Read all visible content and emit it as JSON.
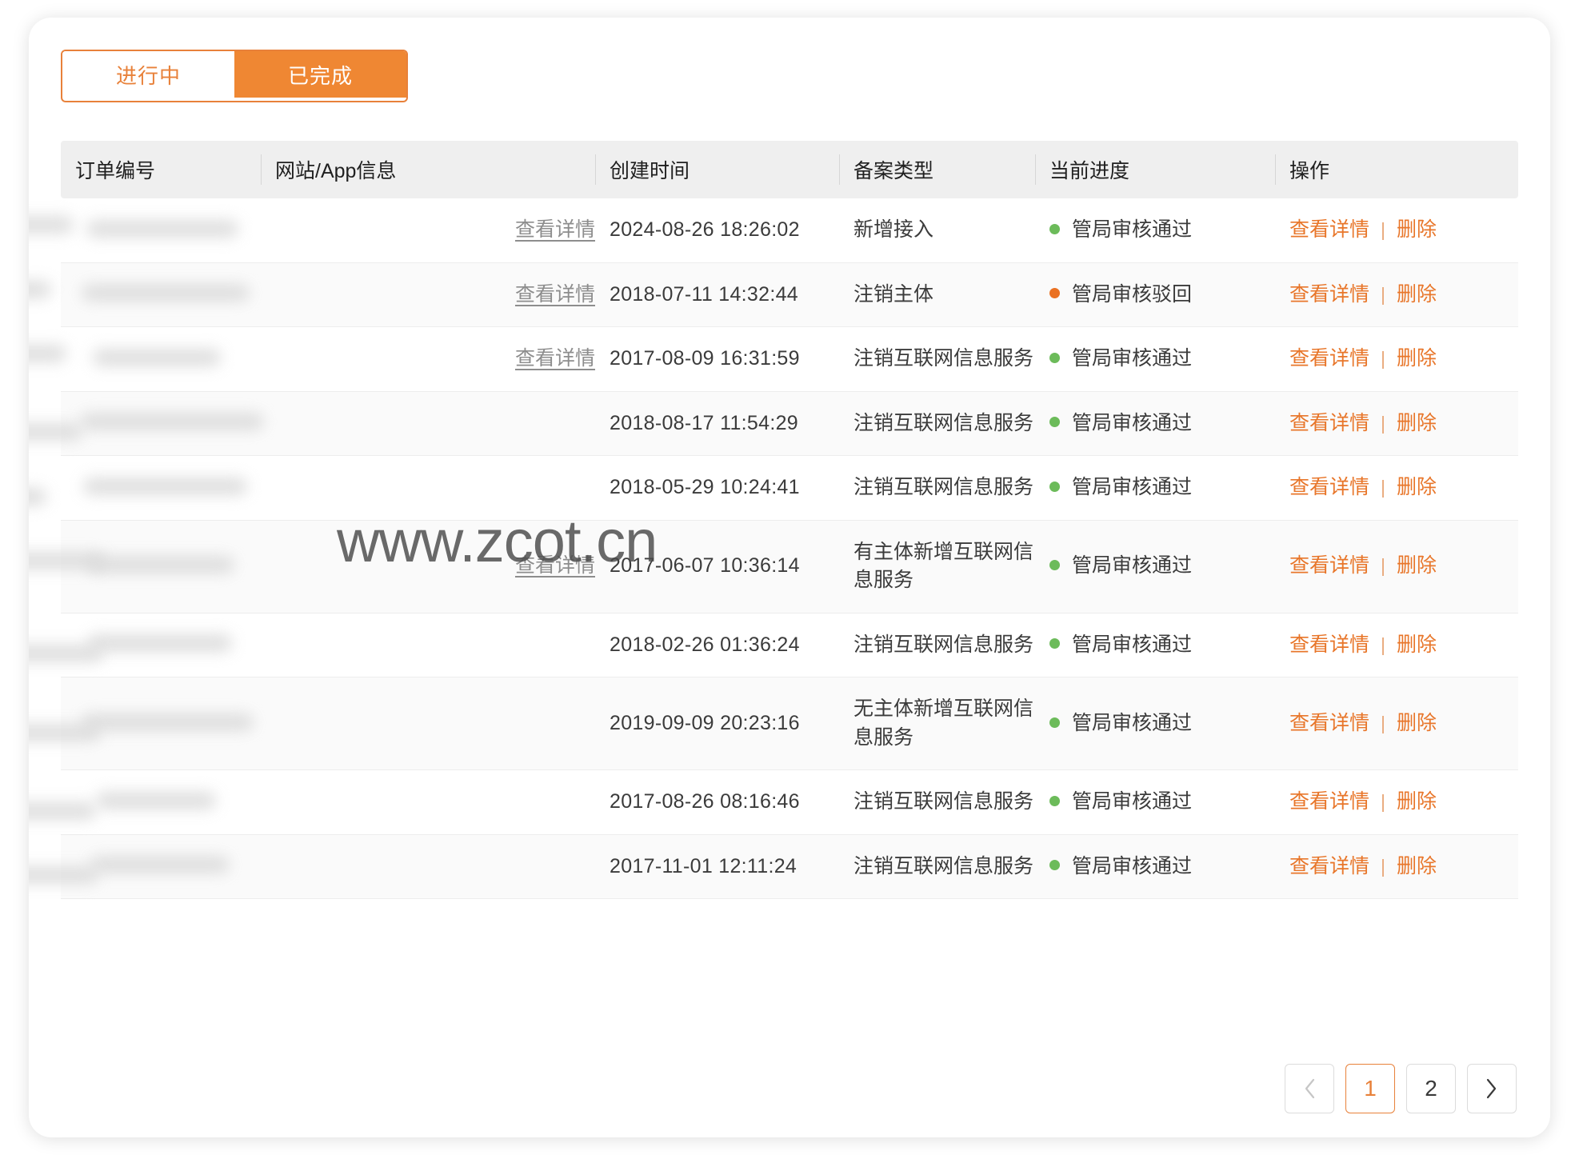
{
  "tabs": [
    {
      "label": "进行中",
      "active": false
    },
    {
      "label": "已完成",
      "active": true
    }
  ],
  "table": {
    "columns": [
      "订单编号",
      "网站/App信息",
      "创建时间",
      "备案类型",
      "当前进度",
      "操作"
    ],
    "site_detail_label": "查看详情",
    "action_view_label": "查看详情",
    "action_separator": "|",
    "action_delete_label": "删除",
    "rows": [
      {
        "order_no": "",
        "site_info": "查看详情",
        "has_site_link": true,
        "created_at": "2024-08-26 18:26:02",
        "record_type": "新增接入",
        "status": "管局审核通过",
        "status_kind": "pass"
      },
      {
        "order_no": "",
        "site_info": "查看详情",
        "has_site_link": true,
        "created_at": "2018-07-11 14:32:44",
        "record_type": "注销主体",
        "status": "管局审核驳回",
        "status_kind": "reject"
      },
      {
        "order_no": "",
        "site_info": "查看详情",
        "has_site_link": true,
        "created_at": "2017-08-09 16:31:59",
        "record_type": "注销互联网信息服务",
        "status": "管局审核通过",
        "status_kind": "pass"
      },
      {
        "order_no": "",
        "site_info": "",
        "has_site_link": false,
        "created_at": "2018-08-17 11:54:29",
        "record_type": "注销互联网信息服务",
        "status": "管局审核通过",
        "status_kind": "pass"
      },
      {
        "order_no": "",
        "site_info": "",
        "has_site_link": false,
        "created_at": "2018-05-29 10:24:41",
        "record_type": "注销互联网信息服务",
        "status": "管局审核通过",
        "status_kind": "pass"
      },
      {
        "order_no": "",
        "site_info": "查看详情",
        "has_site_link": true,
        "created_at": "2017-06-07 10:36:14",
        "record_type": "有主体新增互联网信息服务",
        "status": "管局审核通过",
        "status_kind": "pass"
      },
      {
        "order_no": "",
        "site_info": "",
        "has_site_link": false,
        "created_at": "2018-02-26 01:36:24",
        "record_type": "注销互联网信息服务",
        "status": "管局审核通过",
        "status_kind": "pass"
      },
      {
        "order_no": "",
        "site_info": "",
        "has_site_link": false,
        "created_at": "2019-09-09 20:23:16",
        "record_type": "无主体新增互联网信息服务",
        "status": "管局审核通过",
        "status_kind": "pass"
      },
      {
        "order_no": "",
        "site_info": "",
        "has_site_link": false,
        "created_at": "2017-08-26 08:16:46",
        "record_type": "注销互联网信息服务",
        "status": "管局审核通过",
        "status_kind": "pass"
      },
      {
        "order_no": "",
        "site_info": "",
        "has_site_link": false,
        "created_at": "2017-11-01 12:11:24",
        "record_type": "注销互联网信息服务",
        "status": "管局审核通过",
        "status_kind": "pass"
      }
    ]
  },
  "pagination": {
    "prev_icon": "chevron-left-icon",
    "next_icon": "chevron-right-icon",
    "pages": [
      "1",
      "2"
    ],
    "current_page": "1"
  },
  "watermark": "www.zcot.cn",
  "colors": {
    "accent": "#e8813a",
    "accent_fill": "#ef8733",
    "status_pass": "#6cbb5a",
    "status_reject": "#ea7122",
    "header_bg": "#efefef",
    "row_alt_bg": "#fafafa"
  }
}
